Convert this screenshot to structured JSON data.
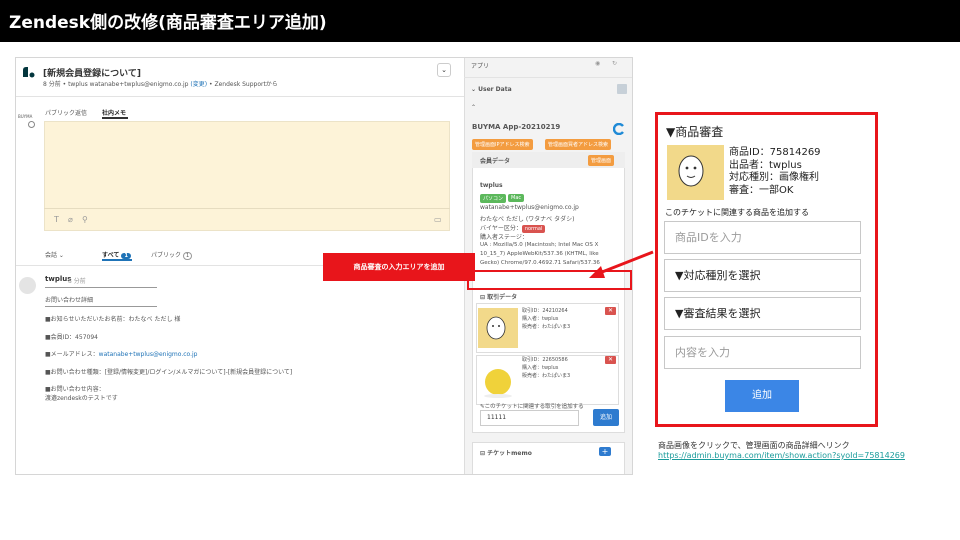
{
  "header": {
    "title": "Zendesk側の改修(商品審査エリア追加)"
  },
  "ticket": {
    "subject": "[新規会員登録について]",
    "meta_prefix": "8 分前 • twplus",
    "meta_email": "watanabe+twplus@enigmo.co.jp",
    "meta_change": "(変更)",
    "meta_suffix": "• Zendesk Supportから",
    "side_label": "BUYMA",
    "tab_public": "パブリック返信",
    "tab_internal": "社内メモ",
    "filter_conv": "会話",
    "filter_all": "すべて",
    "filter_all_count": "1",
    "filter_public": "パブリック",
    "filter_public_count": "1"
  },
  "message": {
    "author": "twplus",
    "time": "8 分前",
    "lines": [
      "お問い合わせ詳細",
      "■お知らせいただいたお名前：わたなべ ただし 様",
      "■会員ID：457094",
      "■メールアドレス：",
      "■お問い合わせ種類：[登録/情報変更]/ログイン/メルマガについて]-[新規会員登録について]",
      "■お問い合わせ内容：",
      "渡邉zendeskのテストです"
    ],
    "email_link": "watanabe+twplus@enigmo.co.jp"
  },
  "apps": {
    "label": "アプリ",
    "user_data": "User Data",
    "app_name": "BUYMA App-20210219",
    "btn_ip": "管理画面IPアドレス検索",
    "btn_email": "管理画面買者アドレス検索",
    "member_section": "会員データ",
    "member_btn": "管理画面",
    "member_name": "twplus",
    "tag_pc": "パソコン",
    "tag_mac": "Mac",
    "member_email": "watanabe+twplus@enigmo.co.jp",
    "member_kana": "わたなべ ただし (ワタナベ タダシ)",
    "buyer_class": "バイヤー区分：",
    "buyer_tag": "normal",
    "stage": "購入者ステージ：",
    "ua_line1": "UA : Mozilla/5.0 (Macintosh; Intel Mac OS X",
    "ua_line2": "10_15_7) AppleWebKit/537.36 (KHTML, like",
    "ua_line3": "Gecko) Chrome/97.0.4692.71 Safari/537.36",
    "trade_section": "取引データ",
    "trades": [
      {
        "id": "取引ID：24210264",
        "buyer": "購入者：twplus",
        "seller": "販売者：わたぱいま3"
      },
      {
        "id": "取引ID：22650586",
        "buyer": "購入者：twplus",
        "seller": "販売者：わたぱいま3"
      }
    ],
    "trade_add_label": "このチケットに関連する取引を追加する",
    "trade_input_value": "11111",
    "trade_add_btn": "追加",
    "memo_section": "チケットmemo"
  },
  "callout": {
    "label": "商品審査の入力エリアを追加"
  },
  "review": {
    "title": "▼商品審査",
    "product_id": "商品ID：75814269",
    "seller": "出品者：twplus",
    "type": "対応種別：画像権利",
    "result": "審査：一部OK",
    "add_label": "このチケットに関連する商品を追加する",
    "input_placeholder": "商品IDを入力",
    "select_type": "▼対応種別を選択",
    "select_result": "▼審査結果を選択",
    "content_placeholder": "内容を入力",
    "add_button": "追加"
  },
  "note": {
    "text": "商品画像をクリックで、管理画面の商品詳細へリンク",
    "url": "https://admin.buyma.com/item/show.action?syoId=75814269"
  },
  "colors": {
    "accent_red": "#e8151b",
    "button_blue": "#3b86e6",
    "compose_bg": "#fdf3d8"
  }
}
